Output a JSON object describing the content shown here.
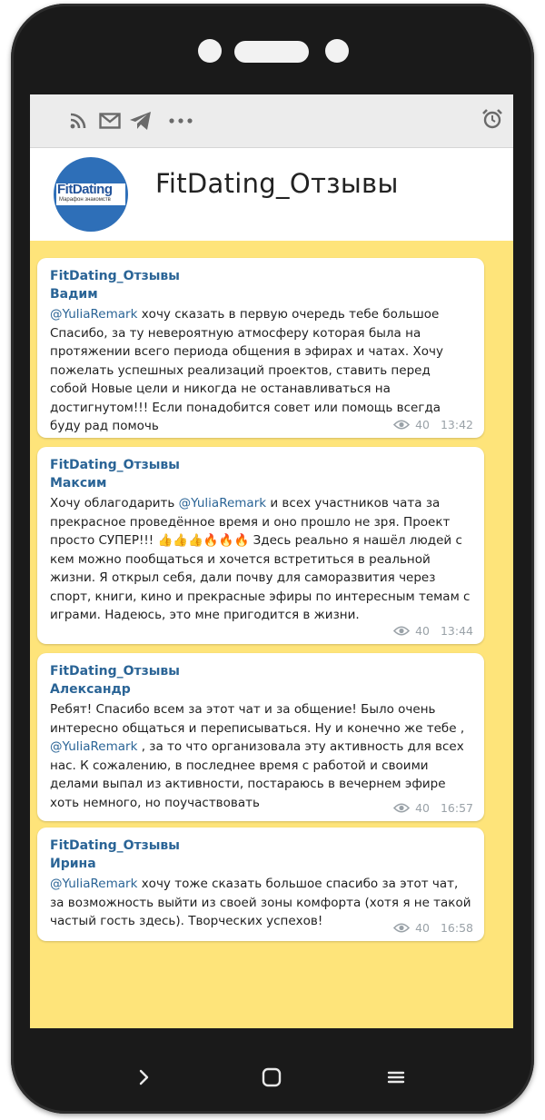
{
  "header": {
    "title": "FitDating_Отзывы",
    "logo_main": "FitDating",
    "logo_sub": "Марафон знакомств"
  },
  "topbar_icons": [
    "rss-icon",
    "mail-icon",
    "telegram-icon",
    "more-icon",
    "alarm-icon"
  ],
  "messages": [
    {
      "channel": "FitDating_Отзывы",
      "author": "Вадим",
      "mention": "@YuliaRemark",
      "text": " хочу сказать в первую очередь тебе большое Спасибо, за ту невероятную атмосферу которая была на протяжении всего периода общения в эфирах и чатах. Хочу пожелать успешных реализаций проектов, ставить перед собой Новые цели и никогда не останавливаться на достигнутом!!! Если понадобится совет или помощь всегда буду рад помочь",
      "views": "40",
      "time": "13:42"
    },
    {
      "channel": "FitDating_Отзывы",
      "author": "Максим",
      "text_before": "Хочу облагодарить ",
      "mention": "@YuliaRemark",
      "text_after": " и всех участников чата за прекрасное проведённое время и оно прошло не зря. Проект просто СУПЕР!!! 👍👍👍🔥🔥🔥 Здесь реально я нашёл людей с кем можно пообщаться и хочется встретиться в реальной жизни. Я открыл себя, дали почву для саморазвития через спорт, книги, кино и прекрасные эфиры по интересным темам с играми. Надеюсь, это мне пригодится в жизни.",
      "views": "40",
      "time": "13:44"
    },
    {
      "channel": "FitDating_Отзывы",
      "author": "Александр",
      "text_before": "Ребят! Спасибо всем за этот чат и за общение! Было очень интересно общаться и переписываться. Ну и конечно же тебе , ",
      "mention": "@YuliaRemark",
      "text_after": " , за то что организовала эту активность для всех нас. К сожалению, в последнее время с работой и своими делами выпал из активности, постараюсь в вечернем эфире хоть немного, но поучаствовать",
      "views": "40",
      "time": "16:57"
    },
    {
      "channel": "FitDating_Отзывы",
      "author": "Ирина",
      "mention": "@YuliaRemark",
      "text": "  хочу тоже сказать большое спасибо за этот чат, за возможность выйти из своей зоны комфорта (хотя я не такой частый гость здесь). Творческих успехов!",
      "views": "40",
      "time": "16:58"
    }
  ],
  "navbar_icons": [
    "back-icon",
    "home-icon",
    "menu-icon"
  ],
  "colors": {
    "background": "#fee47a",
    "link": "#2a6496",
    "phone_body": "#1a1a1a"
  }
}
